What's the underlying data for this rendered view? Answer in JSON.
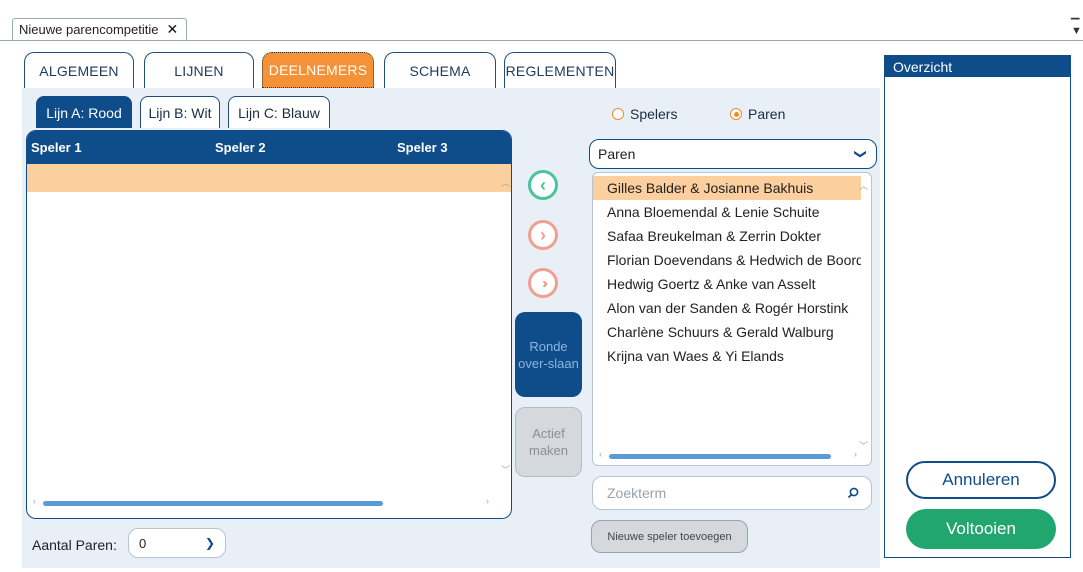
{
  "window": {
    "doc_tab_label": "Nieuwe parencompetitie",
    "close_glyph": "✕"
  },
  "main_tabs": [
    {
      "label": "ALGEMEEN",
      "active": false
    },
    {
      "label": "LIJNEN",
      "active": false
    },
    {
      "label": "DEELNEMERS",
      "active": true
    },
    {
      "label": "SCHEMA",
      "active": false
    },
    {
      "label": "REGLEMENTEN",
      "active": false
    }
  ],
  "sub_tabs": [
    {
      "label": "Lijn A: Rood",
      "active": true
    },
    {
      "label": "Lijn B: Wit",
      "active": false
    },
    {
      "label": "Lijn C: Blauw",
      "active": false
    }
  ],
  "grid": {
    "columns": [
      "Speler 1",
      "Speler 2",
      "Speler 3"
    ]
  },
  "count": {
    "label": "Aantal Paren:",
    "value": "0"
  },
  "actions": {
    "skip_round": "Ronde over-slaan",
    "activate": "Actief maken"
  },
  "mode": {
    "players": "Spelers",
    "pairs": "Paren",
    "selected": "Paren"
  },
  "list_type": {
    "value": "Paren"
  },
  "pairs": [
    "Gilles Balder & Josianne Bakhuis",
    "Anna Bloemendal & Lenie Schuite",
    "Safaa Breukelman & Zerrin Dokter",
    "Florian Doevendans & Hedwich de Boord",
    "Hedwig Goertz & Anke van  Asselt",
    "Alon van der Sanden & Rogér Horstink",
    "Charlène Schuurs & Gerald Walburg",
    "Krijna van Waes & Yi Elands"
  ],
  "search": {
    "placeholder": "Zoekterm"
  },
  "new_player": {
    "label": "Nieuwe speler toevoegen"
  },
  "overview": {
    "title": "Overzicht"
  },
  "footer": {
    "cancel": "Annuleren",
    "finish": "Voltooien"
  },
  "colors": {
    "primary": "#0f4c8a",
    "accent": "#f39236",
    "success": "#21a66f",
    "selection": "#fbcf9e"
  }
}
